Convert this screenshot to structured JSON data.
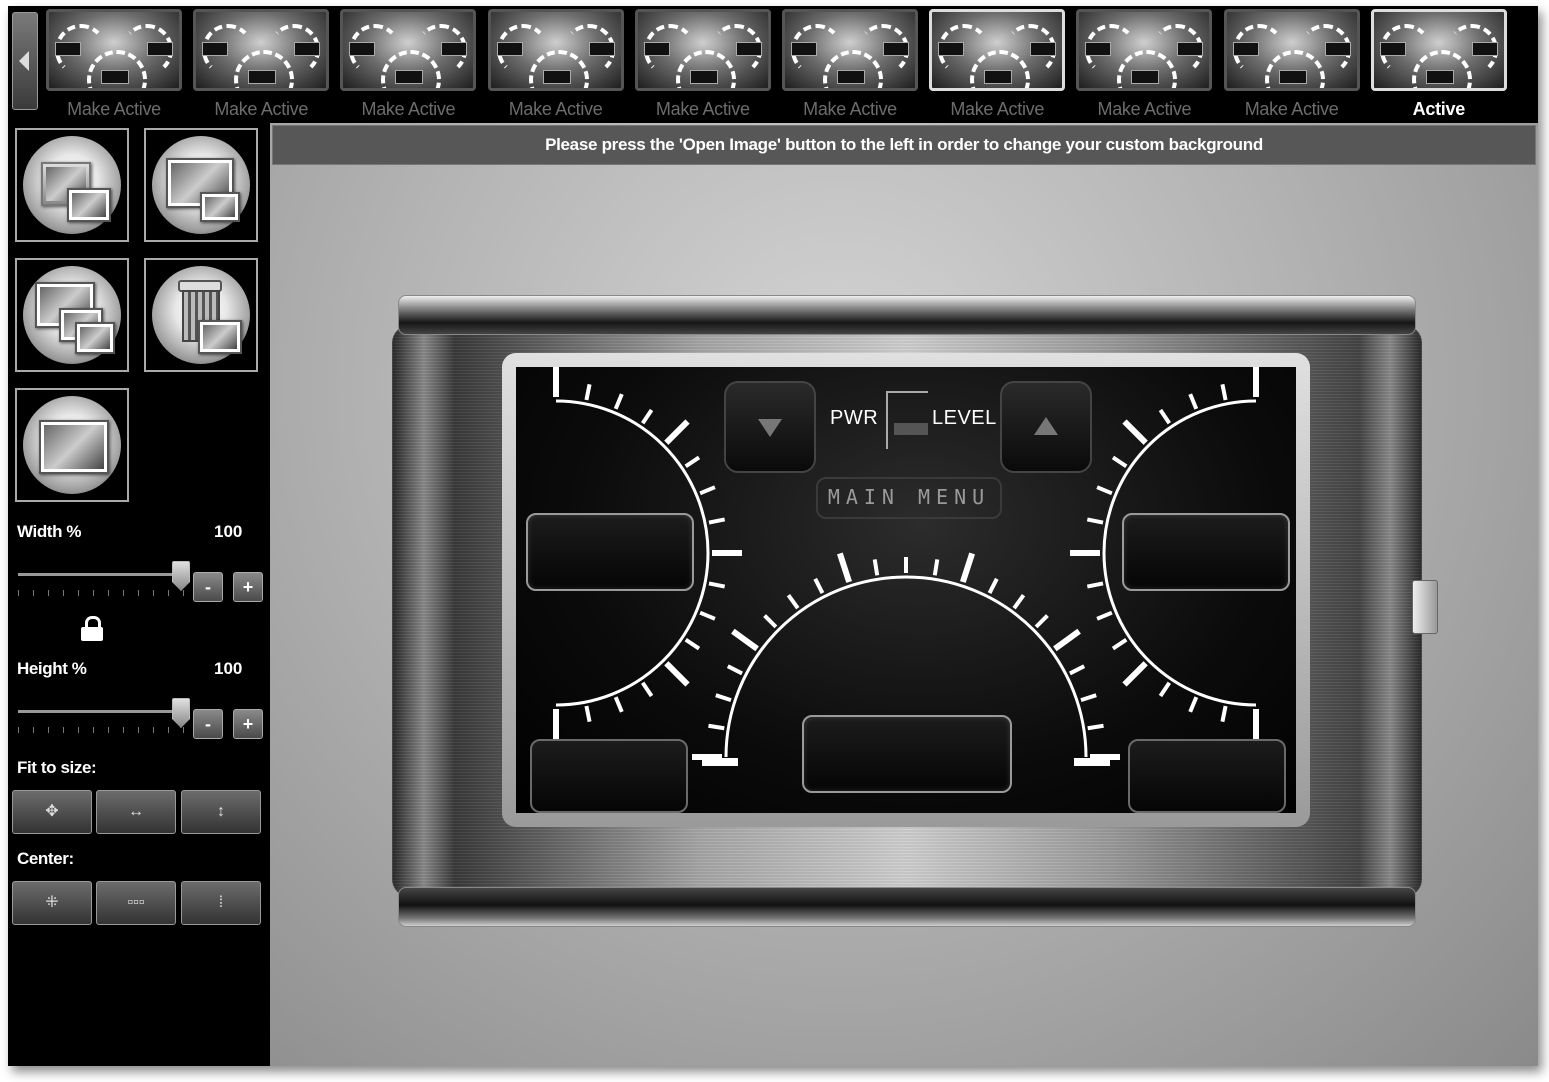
{
  "thumbnails": [
    {
      "label": "Make Active",
      "active": false
    },
    {
      "label": "Make Active",
      "active": false
    },
    {
      "label": "Make Active",
      "active": false
    },
    {
      "label": "Make Active",
      "active": false
    },
    {
      "label": "Make Active",
      "active": false
    },
    {
      "label": "Make Active",
      "active": false
    },
    {
      "label": "Make Active",
      "active": false
    },
    {
      "label": "Make Active",
      "active": false
    },
    {
      "label": "Make Active",
      "active": false
    },
    {
      "label": "Active",
      "active": true
    }
  ],
  "banner": {
    "text": "Please press the 'Open Image' button to the left in order to change your custom background"
  },
  "controls": {
    "width_label": "Width %",
    "width_value": "100",
    "height_label": "Height %",
    "height_value": "100",
    "minus": "-",
    "plus": "+",
    "fit_label": "Fit to size:",
    "center_label": "Center:"
  },
  "device": {
    "pwr": "PWR",
    "level": "LEVEL",
    "main_menu": "MAIN MENU"
  },
  "colors": {
    "accent": "#ffffff",
    "panel": "#000000",
    "banner": "#575757"
  }
}
